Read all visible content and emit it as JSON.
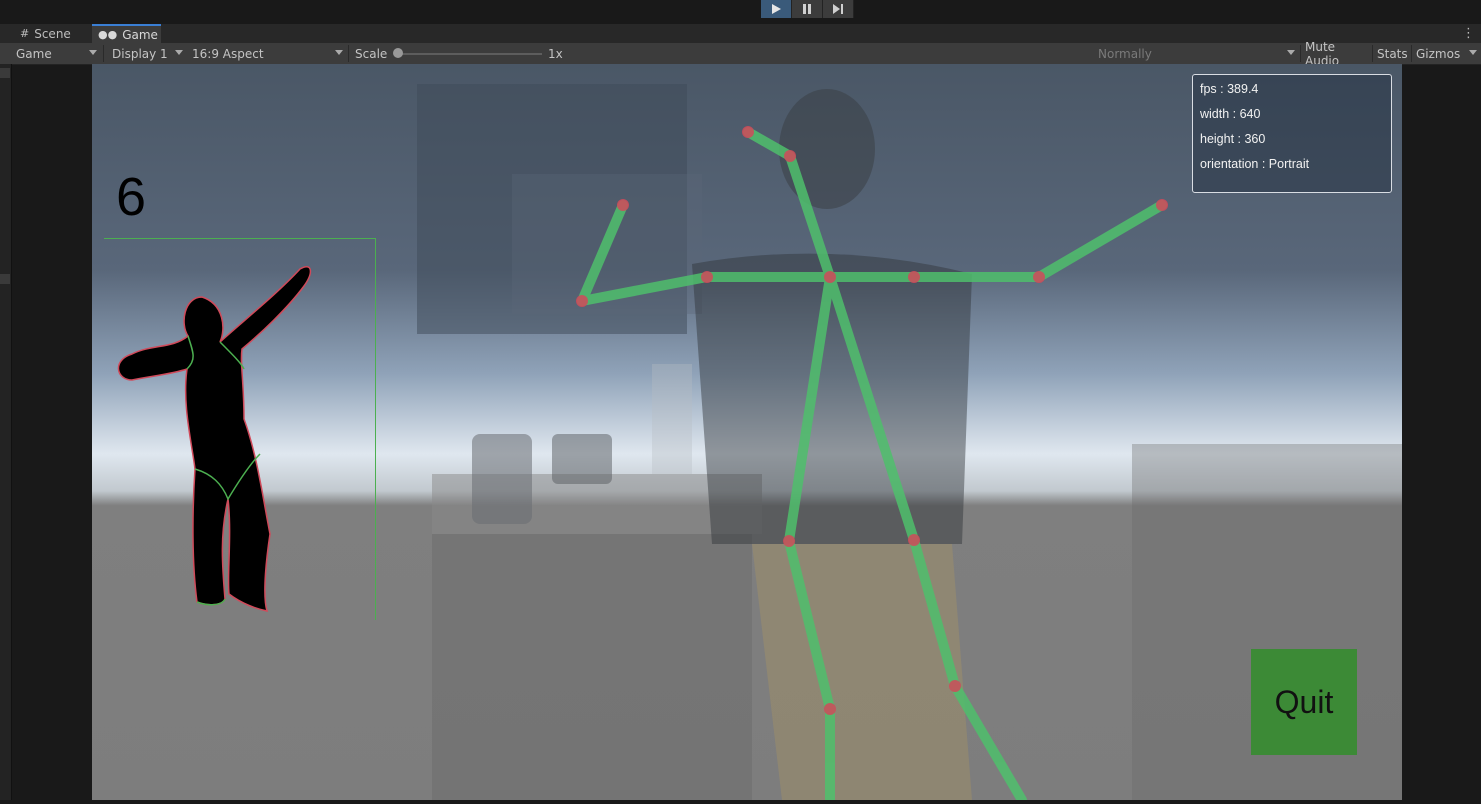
{
  "playback": {
    "play_icon": "play-icon",
    "pause_icon": "pause-icon",
    "step_icon": "step-icon"
  },
  "tabs": {
    "scene": "Scene",
    "game": "Game"
  },
  "game_toolbar": {
    "view_mode": "Game",
    "display": "Display 1",
    "aspect": "16:9 Aspect",
    "scale_label": "Scale",
    "scale_value": "1x",
    "enter_playmode": "Normally",
    "mute_audio": "Mute Audio",
    "stats": "Stats",
    "gizmos": "Gizmos"
  },
  "game_view": {
    "counter": "6",
    "stats_panel": {
      "fps": "fps : 389.4",
      "width": "width : 640",
      "height": "height : 360",
      "orientation": "orientation : Portrait"
    },
    "quit_button": "Quit"
  },
  "colors": {
    "accent": "#3a7fd5",
    "skeleton_bone": "#4fbf6c",
    "skeleton_joint": "#d04a5a",
    "quit_bg": "#3c8a36"
  }
}
